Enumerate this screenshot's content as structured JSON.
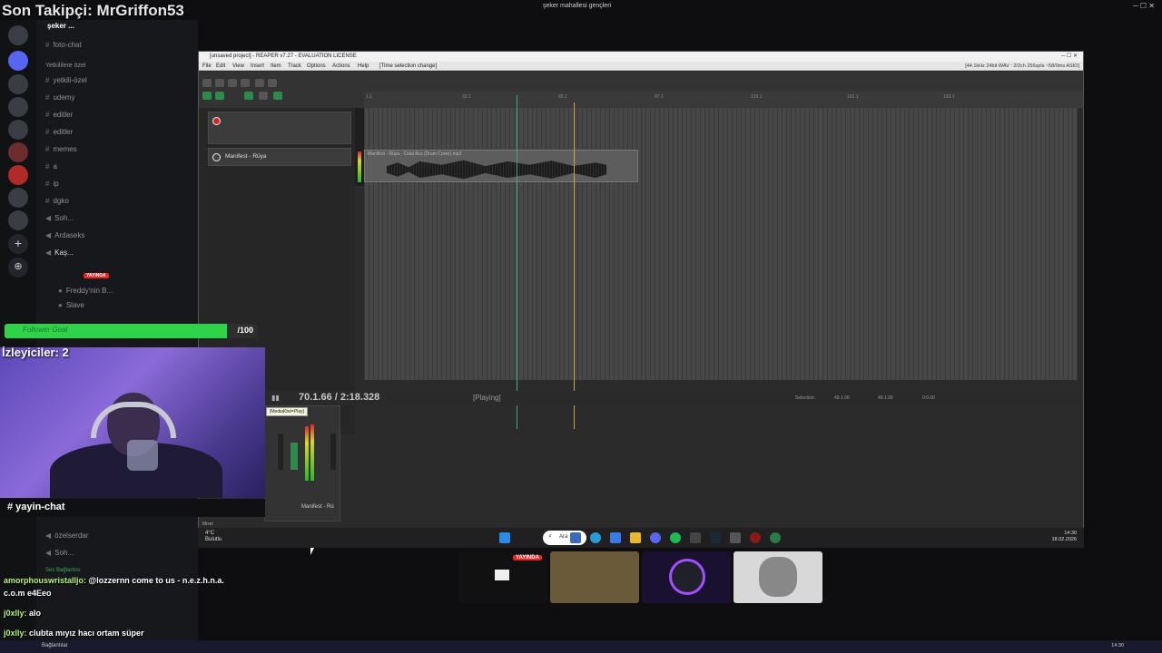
{
  "overlay": {
    "follower_title": "Son Takipçi: MrGriffon53",
    "goal_label": "Follower Goal",
    "goal_count": "/100",
    "goal_progress": 0.88,
    "viewers": "İzleyiciler: 2",
    "chat_channel": "# yayin-chat"
  },
  "discord": {
    "server_name": "şeker ...",
    "window_title": "şeker mahallesi gençleri",
    "channels": [
      {
        "label": "foto-chat",
        "icon": "hash-icon"
      },
      {
        "label": "Yetkililere özel",
        "icon": "category-icon"
      },
      {
        "label": "yetkili-özel",
        "icon": "hash-icon"
      },
      {
        "label": "udemy",
        "icon": "hash-icon"
      },
      {
        "label": "editler",
        "icon": "hash-icon"
      },
      {
        "label": "editler",
        "icon": "hash-icon"
      },
      {
        "label": "memes",
        "icon": "hash-icon"
      },
      {
        "label": "a",
        "icon": "hash-icon"
      },
      {
        "label": "ip",
        "icon": "hash-icon"
      },
      {
        "label": "dgko",
        "icon": "hash-icon"
      },
      {
        "label": "Soh...",
        "icon": "speaker-icon"
      },
      {
        "label": "Ardaseks",
        "icon": "speaker-icon"
      },
      {
        "label": "Kaş...",
        "icon": "speaker-icon"
      },
      {
        "label": "Freddy'nin B...",
        "icon": "avatar-icon"
      },
      {
        "label": "Slave",
        "icon": "avatar-icon"
      },
      {
        "label": "özelserdar",
        "icon": "speaker-icon"
      },
      {
        "label": "Soh...",
        "icon": "speaker-icon"
      }
    ],
    "live_badge": "YAYINDA",
    "voice_status": "Ses Bağlantısı",
    "bottom_label": "Bağlantılar"
  },
  "chat": [
    {
      "user": "amorphouswristalljo:",
      "text": "@lozzernn come to us - n.e.z.h.n.a."
    },
    {
      "user": "",
      "text": "c.o.m e4Eeo"
    },
    {
      "user": "j0xlly:",
      "text": "alo"
    },
    {
      "user": "j0xlly:",
      "text": "clubta mıyız hacı ortam süper"
    }
  ],
  "reaper": {
    "title": "[unsaved project] - REAPER v7.27 - EVALUATION LICENSE",
    "menu": [
      "File",
      "Edit",
      "View",
      "Insert",
      "Item",
      "Track",
      "Options",
      "Actions",
      "Help",
      "[Time selection change]"
    ],
    "status": "[44.1kHz 24bit WAV : 2/2ch 256spls ~58/0ms ASIO]",
    "ruler_ticks": [
      "1.1",
      "33.1",
      "65.1",
      "97.1",
      "129.1",
      "161.1",
      "193.1"
    ],
    "track_name": "Manifest - Rüya",
    "item_label": "Manifest - Rüya - Celal Acu (Drum Cover).mp3",
    "time_display": "70.1.66 / 2:18.328",
    "play_state": "[Playing]",
    "selection_label": "Selection:",
    "selection_values": [
      "49.1.00",
      "49.1.00",
      "0:0.00"
    ],
    "tooltip": "[MediaKbd=Play]",
    "mixer_track_name": "Manifest - Rü",
    "mixer_label": "Mixer"
  },
  "taskbar": {
    "weather_temp": "4°C",
    "weather_desc": "Bulutlu",
    "search": "Ara",
    "time": "14:30",
    "date": "18.02.2026"
  },
  "os": {
    "time": "14:30"
  },
  "colors": {
    "goal_green": "#2fd34a",
    "reaper_cursor": "#d4a82a",
    "live_red": "#e22222"
  }
}
